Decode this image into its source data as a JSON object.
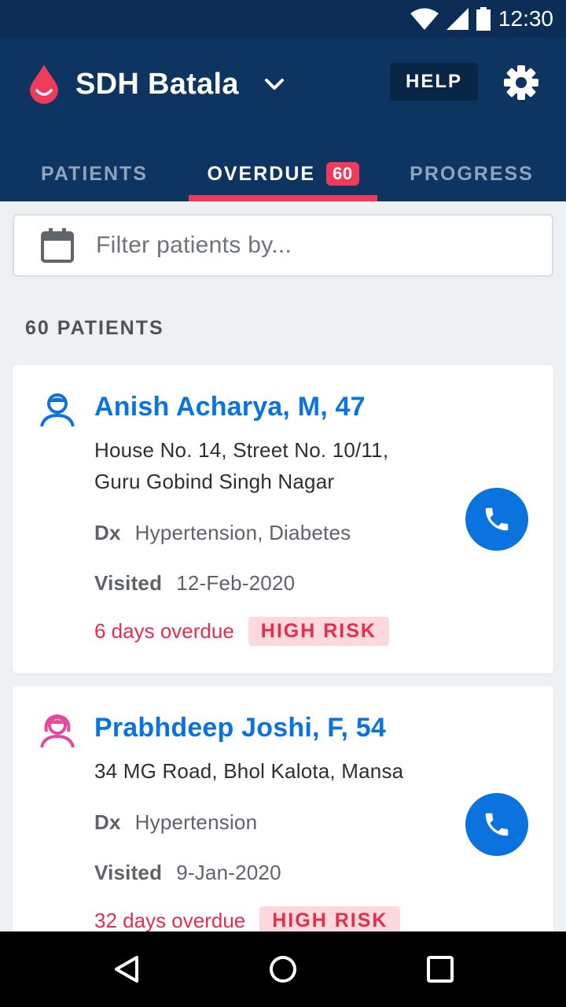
{
  "status_bar": {
    "time": "12:30"
  },
  "app_bar": {
    "facility_name": "SDH Batala",
    "help_label": "HELP"
  },
  "tabs": [
    {
      "label": "PATIENTS",
      "active": false
    },
    {
      "label": "OVERDUE",
      "badge": "60",
      "active": true
    },
    {
      "label": "PROGRESS",
      "active": false
    }
  ],
  "filter": {
    "placeholder": "Filter patients by..."
  },
  "patient_count": "60 PATIENTS",
  "patients": [
    {
      "name": "Anish Acharya, M, 47",
      "gender": "male",
      "address_lines": [
        "House No. 14, Street No. 10/11,",
        "Guru Gobind Singh Nagar"
      ],
      "dx_label": "Dx",
      "dx": "Hypertension, Diabetes",
      "visited_label": "Visited",
      "visited": "12-Feb-2020",
      "overdue": "6 days overdue",
      "risk": "HIGH RISK"
    },
    {
      "name": "Prabhdeep Joshi, F, 54",
      "gender": "female",
      "address_lines": [
        "34 MG Road, Bhol Kalota, Mansa"
      ],
      "dx_label": "Dx",
      "dx": "Hypertension",
      "visited_label": "Visited",
      "visited": "9-Jan-2020",
      "overdue": "32 days overdue",
      "risk": "HIGH RISK"
    }
  ],
  "colors": {
    "app_bar": "#0e3461",
    "status_bar": "#0c2d55",
    "accent": "#ef3b5b",
    "link_blue": "#0b73de",
    "female_pink": "#e8489b",
    "risk_bg": "#fdd9de"
  },
  "icons": {
    "logo": "blood-drop-icon",
    "dropdown": "chevron-down-icon",
    "settings": "gear-icon",
    "filter": "calendar-icon",
    "male": "male-patient-icon",
    "female": "female-patient-icon",
    "call": "phone-icon",
    "nav": [
      "back-icon",
      "home-icon",
      "recents-icon"
    ]
  }
}
